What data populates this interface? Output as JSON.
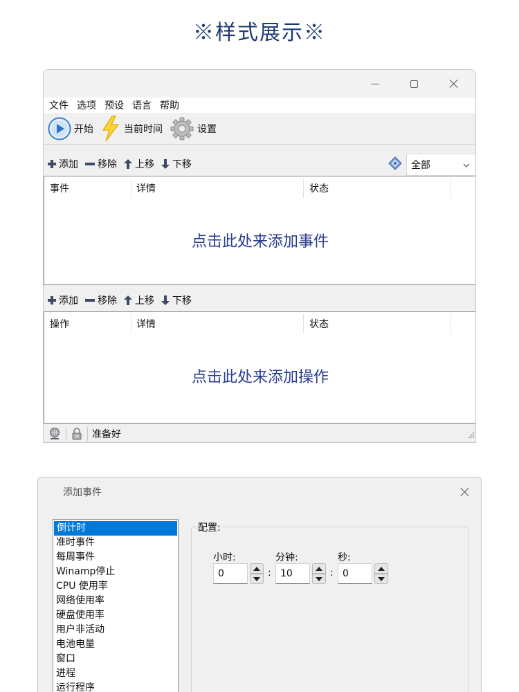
{
  "page_title": "※样式展示※",
  "main_window": {
    "menu": [
      "文件",
      "选项",
      "预设",
      "语言",
      "帮助"
    ],
    "toolbar": {
      "start_label": "开始",
      "current_time_label": "当前时间",
      "settings_label": "设置"
    },
    "list_toolbar": {
      "add_label": "添加",
      "remove_label": "移除",
      "move_up_label": "上移",
      "move_down_label": "下移"
    },
    "filter": {
      "selected": "全部"
    },
    "events_table": {
      "columns": [
        "事件",
        "详情",
        "状态"
      ],
      "empty_text": "点击此处来添加事件"
    },
    "actions_table": {
      "columns": [
        "操作",
        "详情",
        "状态"
      ],
      "empty_text": "点击此处来添加操作"
    },
    "status": {
      "text": "准备好"
    }
  },
  "add_event_dialog": {
    "title": "添加事件",
    "event_types": [
      "倒计时",
      "准时事件",
      "每周事件",
      "Winamp停止",
      "CPU 使用率",
      "网络使用率",
      "硬盘使用率",
      "用户非活动",
      "电池电量",
      "窗口",
      "进程",
      "运行程序"
    ],
    "selected_index": 0,
    "config": {
      "legend": "配置:",
      "hours_label": "小时:",
      "minutes_label": "分钟:",
      "seconds_label": "秒:",
      "hours_value": "0",
      "minutes_value": "10",
      "seconds_value": "0",
      "separator": ":"
    }
  }
}
